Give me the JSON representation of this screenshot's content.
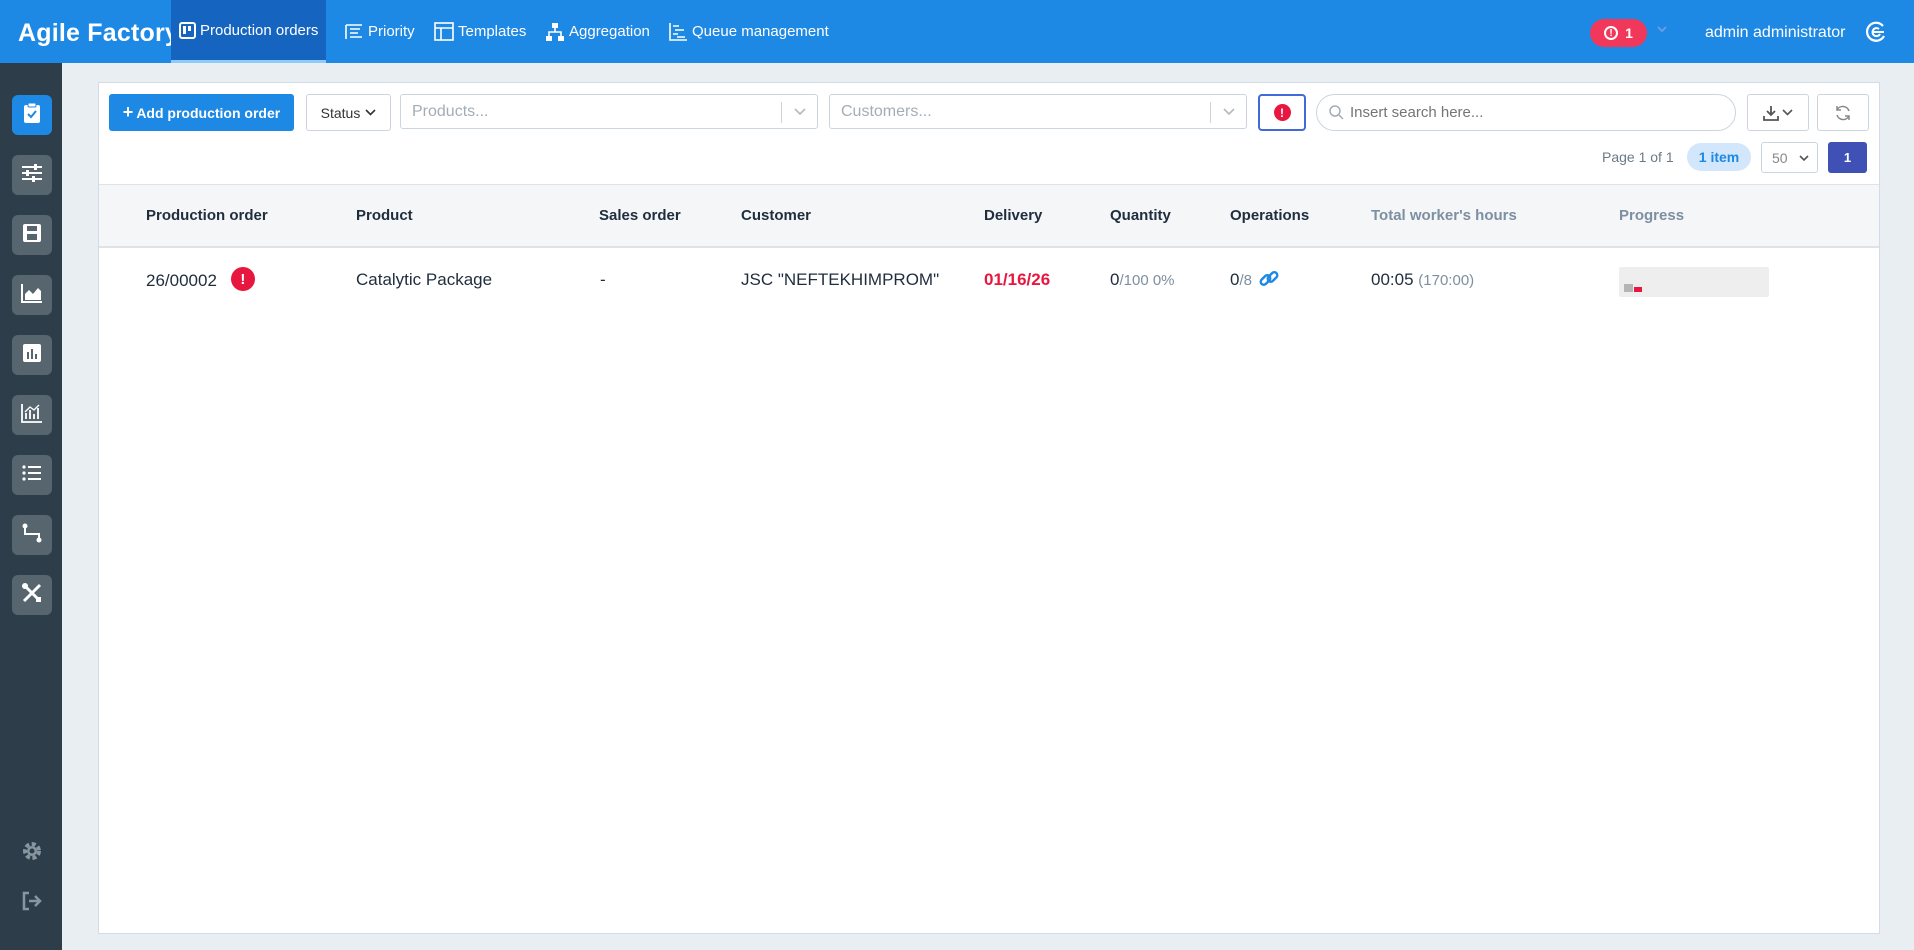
{
  "app": {
    "title": "Agile Factory"
  },
  "nav": {
    "tabs": [
      {
        "label": "Production orders",
        "icon": "board-icon"
      },
      {
        "label": "Priority",
        "icon": "priority-icon"
      },
      {
        "label": "Templates",
        "icon": "template-icon"
      },
      {
        "label": "Aggregation",
        "icon": "hierarchy-icon"
      },
      {
        "label": "Queue management",
        "icon": "queue-icon"
      }
    ]
  },
  "header": {
    "alert_count": "1",
    "user_name": "admin administrator"
  },
  "sidebar": {
    "items": [
      {
        "icon": "clipboard-check-icon",
        "active": true
      },
      {
        "icon": "sliders-icon"
      },
      {
        "icon": "save-icon"
      },
      {
        "icon": "area-chart-icon"
      },
      {
        "icon": "bar-chart-icon"
      },
      {
        "icon": "line-bar-chart-icon"
      },
      {
        "icon": "list-icon"
      },
      {
        "icon": "route-icon"
      },
      {
        "icon": "tools-icon"
      }
    ],
    "bottom": [
      {
        "icon": "gear-icon"
      },
      {
        "icon": "logout-icon"
      }
    ]
  },
  "toolbar": {
    "add_label": "Add production order",
    "status_label": "Status",
    "products_placeholder": "Products...",
    "customers_placeholder": "Customers...",
    "search_placeholder": "Insert search here..."
  },
  "pagination": {
    "page_info": "Page 1 of 1",
    "items_badge": "1 item",
    "per_page": "50",
    "current_page": "1"
  },
  "table": {
    "columns": [
      "Production order",
      "Product",
      "Sales order",
      "Customer",
      "Delivery",
      "Quantity",
      "Operations",
      "Total worker's hours",
      "Progress"
    ],
    "rows": [
      {
        "order": "26/00002",
        "product": "Catalytic Package",
        "sales_order": "-",
        "customer": "JSC \"NEFTEKHIMPROM\"",
        "delivery": "01/16/26",
        "qty_done": "0",
        "qty_total": "/100 0%",
        "ops_done": "0",
        "ops_total": "/8",
        "hours": "00:05",
        "hours_planned": "(170:00)"
      }
    ]
  },
  "colors": {
    "primary": "#1e88e5",
    "danger": "#e8173f",
    "sidebar": "#2d3e4a"
  }
}
